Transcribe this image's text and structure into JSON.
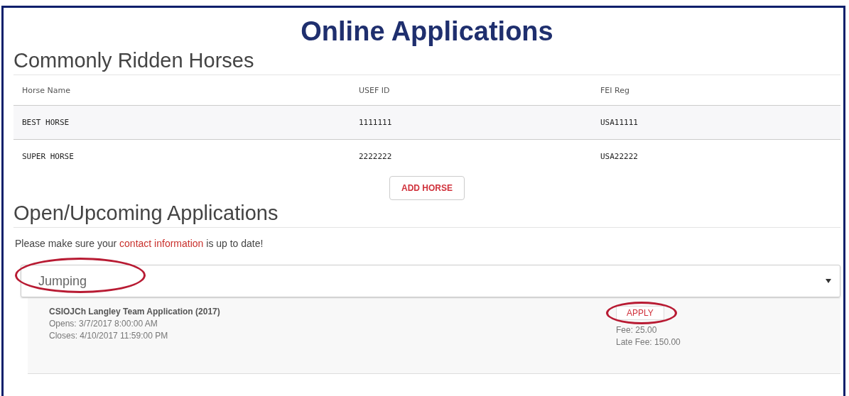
{
  "title": "Online Applications",
  "horses": {
    "heading": "Commonly Ridden Horses",
    "columns": [
      "Horse Name",
      "USEF ID",
      "FEI Reg"
    ],
    "rows": [
      [
        "BEST HORSE",
        "1111111",
        "USA11111"
      ],
      [
        "SUPER HORSE",
        "2222222",
        "USA22222"
      ]
    ],
    "add_button": "ADD HORSE"
  },
  "applications": {
    "heading": "Open/Upcoming Applications",
    "notice": {
      "before": "Please make sure your ",
      "link": "contact information",
      "after": " is up to date!"
    },
    "discipline_select": {
      "value": "Jumping",
      "circled": true
    },
    "items": [
      {
        "name": "CSIOJCh Langley Team Application (2017)",
        "opens": "Opens: 3/7/2017 8:00:00 AM",
        "closes": "Closes: 4/10/2017 11:59:00 PM",
        "apply": "APPLY",
        "apply_circled": true,
        "fee": "Fee: 25.00",
        "late_fee": "Late Fee: 150.00"
      }
    ]
  }
}
